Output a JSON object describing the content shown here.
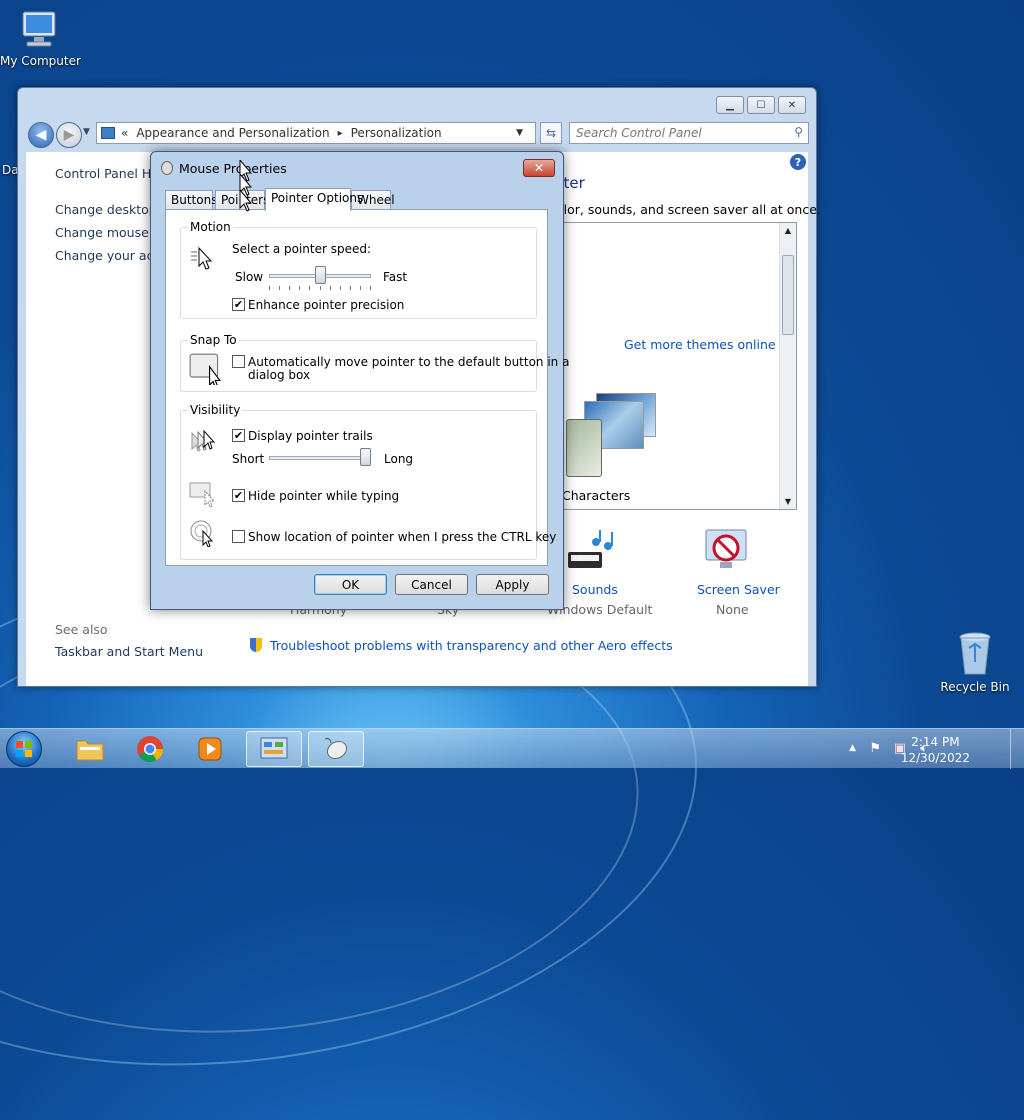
{
  "desktop": {
    "my_computer_label": "My Computer",
    "recycle_bin_label": "Recycle Bin",
    "partial_label": "Da"
  },
  "control_panel": {
    "breadcrumb": {
      "sep": "«",
      "item1": "Appearance and Personalization",
      "arrow": "▸",
      "item2": "Personalization"
    },
    "search_placeholder": "Search Control Panel",
    "left_nav": {
      "home": "Control Panel Hor",
      "link1": "Change desktop ic",
      "link2": "Change mouse po",
      "link3": "Change your acco",
      "see_also": "See also",
      "taskbar_link": "Taskbar and Start Menu"
    },
    "main": {
      "heading_fragment": "uter",
      "description_fragment": "olor, sounds, and screen saver all at once.",
      "get_more_themes": "Get more themes online",
      "characters_label": "Characters",
      "harmony_label": "Harmony",
      "sky_label": "Sky",
      "sounds_label": "Sounds",
      "sounds_value": "Windows Default",
      "screensaver_label": "Screen Saver",
      "screensaver_value": "None",
      "troubleshoot_link": "Troubleshoot problems with transparency and other Aero effects"
    }
  },
  "mouse_dialog": {
    "title": "Mouse Properties",
    "tabs": [
      "Buttons",
      "Pointers",
      "Pointer Options",
      "Wheel"
    ],
    "active_tab": "Pointer Options",
    "motion": {
      "group_label": "Motion",
      "speed_label": "Select a pointer speed:",
      "slow": "Slow",
      "fast": "Fast",
      "speed_fraction": 0.5,
      "precision_label": "Enhance pointer precision",
      "precision_checked": true
    },
    "snap_to": {
      "group_label": "Snap To",
      "label_line1": "Automatically move pointer to the default button in a",
      "label_line2": "dialog box",
      "checked": false
    },
    "visibility": {
      "group_label": "Visibility",
      "trails_label": "Display pointer trails",
      "trails_checked": true,
      "short": "Short",
      "long": "Long",
      "trail_fraction": 1.0,
      "hide_label": "Hide pointer while typing",
      "hide_checked": true,
      "ctrl_label": "Show location of pointer when I press the CTRL key",
      "ctrl_checked": false
    },
    "buttons": {
      "ok": "OK",
      "cancel": "Cancel",
      "apply": "Apply"
    }
  },
  "taskbar": {
    "time": "2:14 PM",
    "date": "12/30/2022"
  }
}
